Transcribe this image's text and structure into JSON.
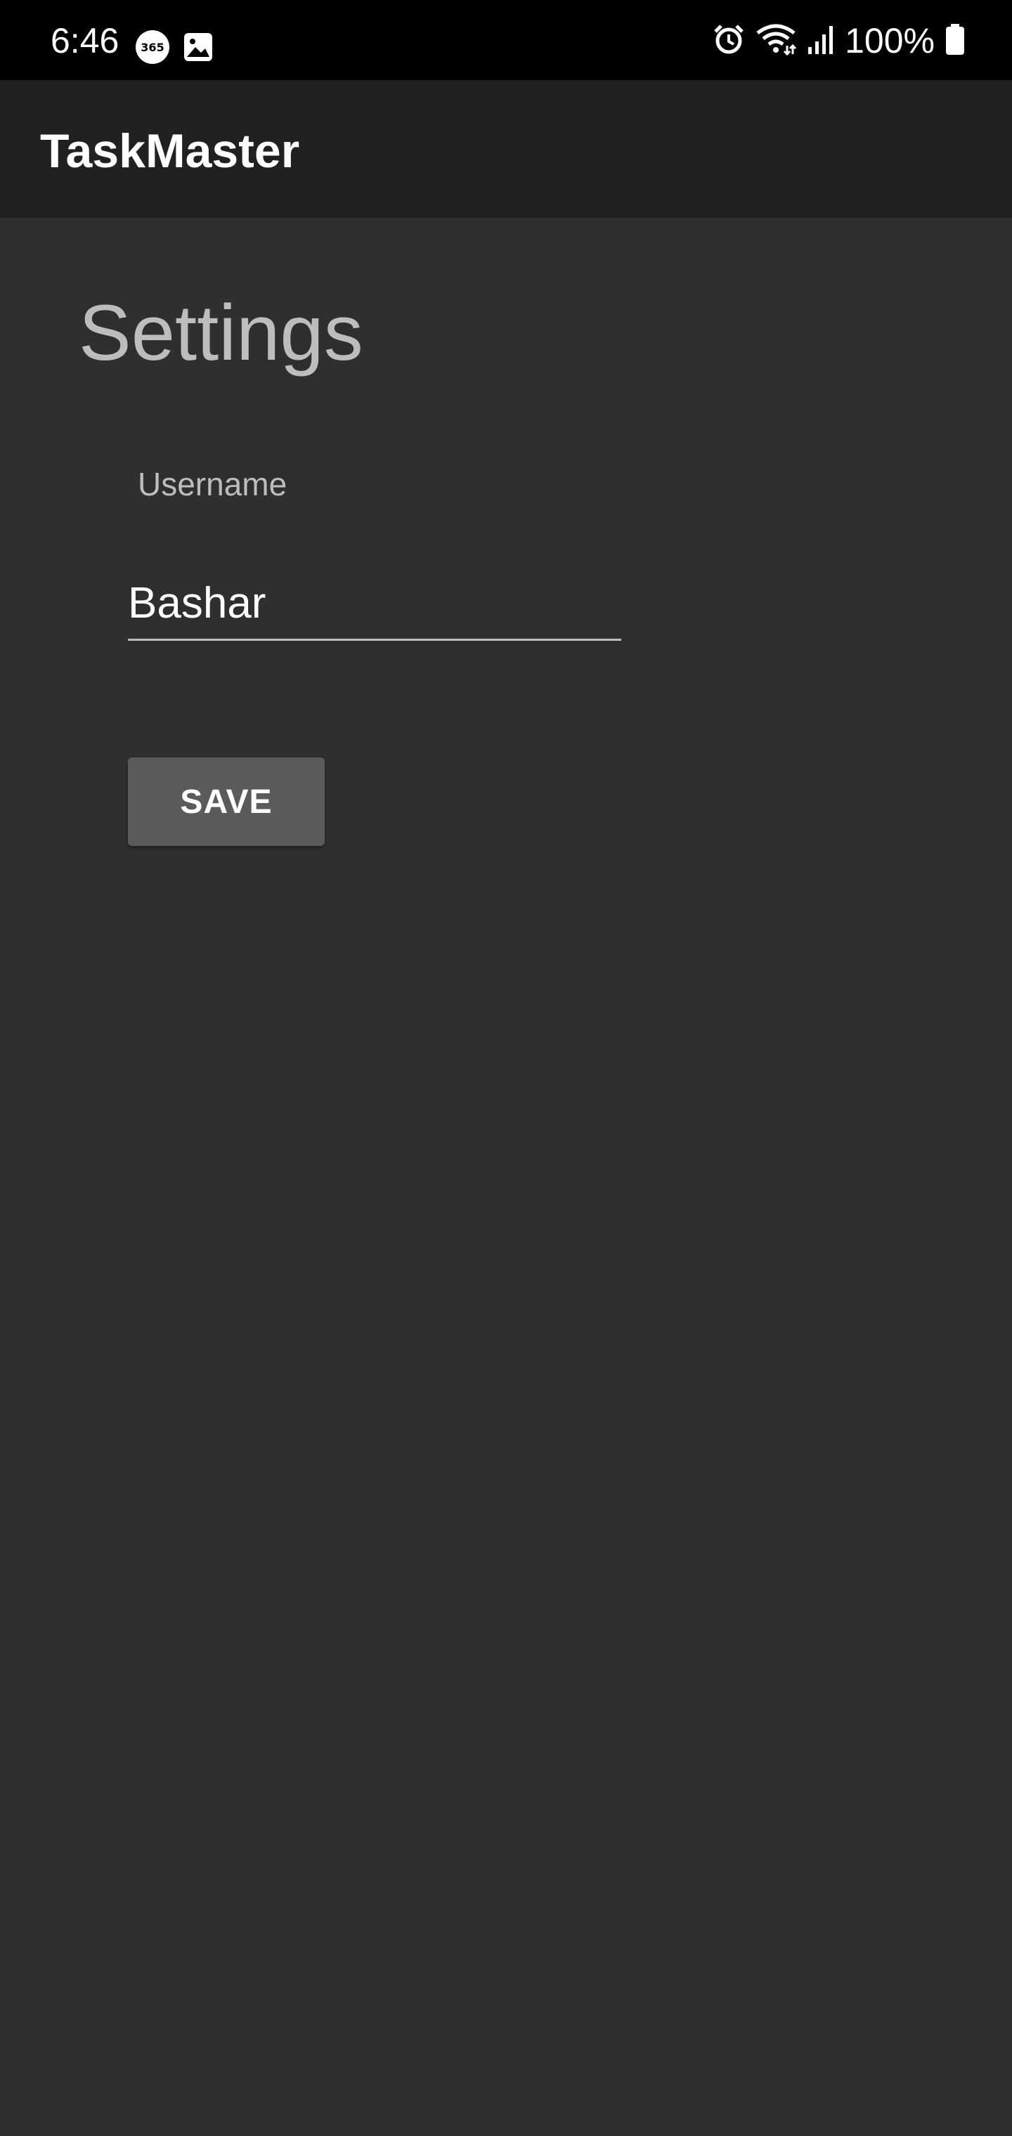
{
  "status_bar": {
    "time": "6:46",
    "battery": "100%",
    "left_icons": [
      "365-badge-icon",
      "image-icon"
    ],
    "right_icons": [
      "alarm-icon",
      "wifi-icon",
      "signal-icon",
      "battery-icon"
    ]
  },
  "app_bar": {
    "title": "TaskMaster"
  },
  "settings": {
    "heading": "Settings",
    "username_label": "Username",
    "username_value": "Bashar",
    "save_label": "SAVE"
  },
  "colors": {
    "background": "#2f2f2f",
    "app_bar": "#212121",
    "status_bar": "#000000",
    "button": "#5b5b5d",
    "muted_text": "#bdbdbd"
  }
}
